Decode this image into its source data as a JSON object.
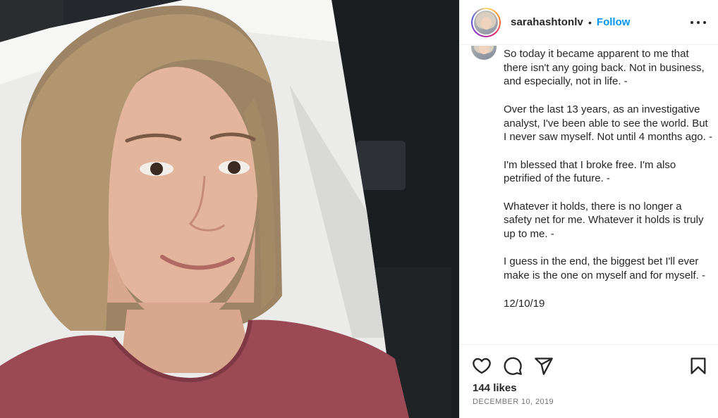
{
  "post": {
    "username": "sarahashtonlv",
    "separator": "•",
    "follow_label": "Follow",
    "caption_paragraphs": [
      "So today it became apparent to me that there isn't any going back. Not in business, and especially, not in life. -",
      "Over the last 13 years, as an investigative analyst, I've been able to see the world. But I never saw myself. Not until 4 months ago. -",
      "I'm blessed that I broke free. I'm also petrified of the future. -",
      "Whatever it holds, there is no longer a safety net for me. Whatever it holds is truly up to me. -",
      "I guess in the end, the biggest bet I'll ever make is the one on myself and for myself. -",
      "12/10/19"
    ],
    "likes_text": "144 likes",
    "date_text": "DECEMBER 10, 2019"
  },
  "icons": {
    "more": "more-options-icon",
    "like": "heart-icon",
    "comment": "comment-icon",
    "share": "paper-plane-icon",
    "save": "bookmark-icon"
  },
  "colors": {
    "link_blue": "#0095f6",
    "text": "#262626",
    "secondary_text": "#737373",
    "divider": "#efefef"
  }
}
